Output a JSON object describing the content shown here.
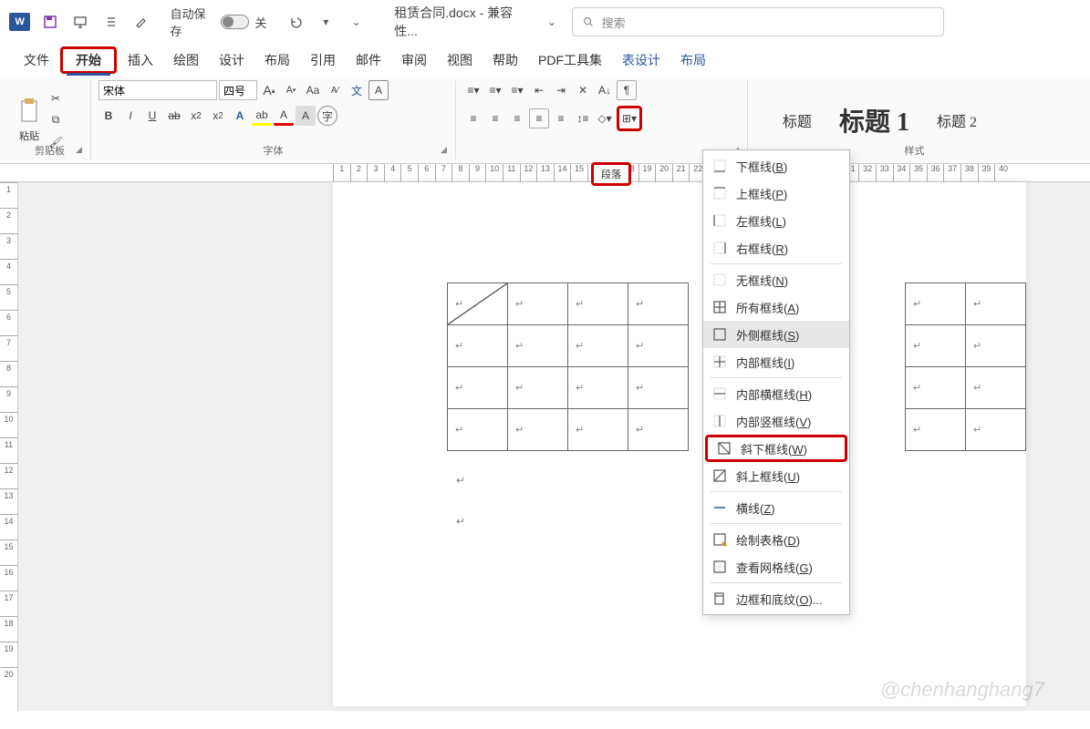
{
  "titlebar": {
    "app": "W",
    "autosave_label": "自动保存",
    "autosave_state": "关",
    "doc_title": "租赁合同.docx - 兼容性...",
    "search_placeholder": "搜索"
  },
  "tabs": [
    "文件",
    "开始",
    "插入",
    "绘图",
    "设计",
    "布局",
    "引用",
    "邮件",
    "审阅",
    "视图",
    "帮助",
    "PDF工具集",
    "表设计",
    "布局"
  ],
  "active_tab": "开始",
  "ribbon": {
    "clipboard": {
      "label": "剪贴板",
      "paste": "粘贴"
    },
    "font": {
      "label": "字体",
      "name": "宋体",
      "size": "四号",
      "wen": "文",
      "abc_yellow": "ab",
      "A_red": "A"
    },
    "paragraph": {
      "label": "段落"
    },
    "styles": {
      "label": "样式",
      "title": "标题",
      "h1": "标题 1",
      "h2": "标题 2"
    }
  },
  "border_menu": [
    {
      "icon": "border-bottom",
      "label": "下框线",
      "key": "B"
    },
    {
      "icon": "border-top",
      "label": "上框线",
      "key": "P"
    },
    {
      "icon": "border-left",
      "label": "左框线",
      "key": "L"
    },
    {
      "icon": "border-right",
      "label": "右框线",
      "key": "R"
    },
    {
      "sep": true
    },
    {
      "icon": "border-none",
      "label": "无框线",
      "key": "N"
    },
    {
      "icon": "border-all",
      "label": "所有框线",
      "key": "A"
    },
    {
      "icon": "border-outside",
      "label": "外侧框线",
      "key": "S",
      "hover": true
    },
    {
      "icon": "border-inside",
      "label": "内部框线",
      "key": "I"
    },
    {
      "sep": true
    },
    {
      "icon": "border-inside-h",
      "label": "内部横框线",
      "key": "H"
    },
    {
      "icon": "border-inside-v",
      "label": "内部竖框线",
      "key": "V"
    },
    {
      "icon": "diag-down",
      "label": "斜下框线",
      "key": "W",
      "boxed": true
    },
    {
      "icon": "diag-up",
      "label": "斜上框线",
      "key": "U"
    },
    {
      "sep": true
    },
    {
      "icon": "hline",
      "label": "横线",
      "key": "Z"
    },
    {
      "sep": true
    },
    {
      "icon": "draw-table",
      "label": "绘制表格",
      "key": "D"
    },
    {
      "icon": "view-grid",
      "label": "查看网格线",
      "key": "G"
    },
    {
      "sep": true
    },
    {
      "icon": "borders-shading",
      "label": "边框和底纹",
      "key": "O",
      "ellipsis": true
    }
  ],
  "watermark": "@chenhanghang7"
}
